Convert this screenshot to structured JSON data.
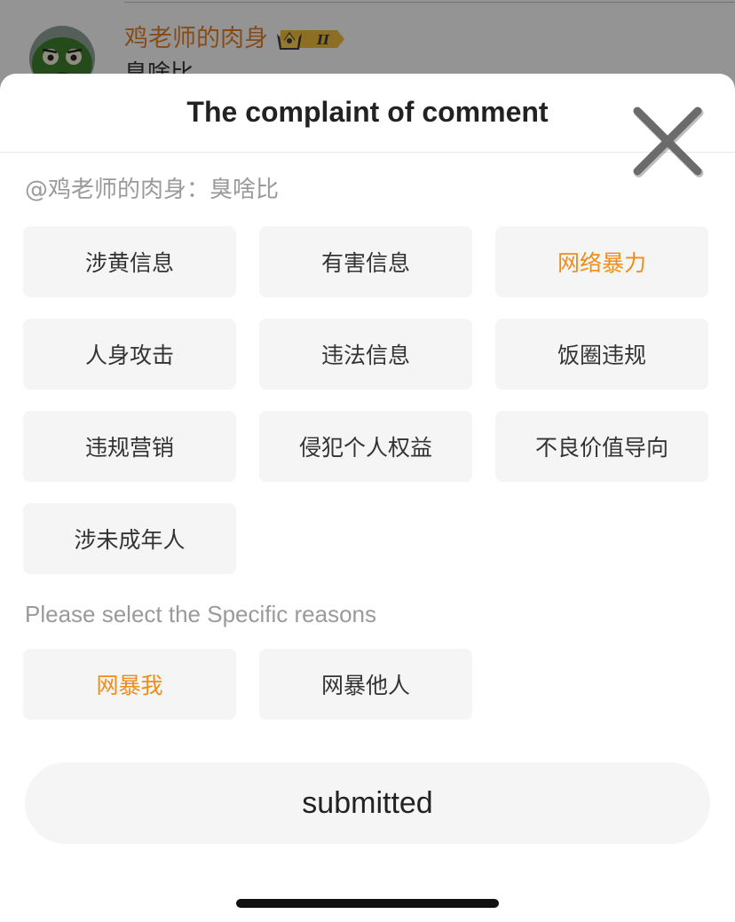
{
  "background_comment": {
    "username": "鸡老师的肉身",
    "comment_text": "臭啥比",
    "badge_level": "II",
    "icons": [
      "avatar-frog",
      "crown-badge"
    ]
  },
  "sheet": {
    "title": "The complaint of comment",
    "close_icon": "close-icon",
    "target_line": "@鸡老师的肉身：臭啥比",
    "categories": [
      {
        "label": "涉黄信息",
        "selected": false
      },
      {
        "label": "有害信息",
        "selected": false
      },
      {
        "label": "网络暴力",
        "selected": true
      },
      {
        "label": "人身攻击",
        "selected": false
      },
      {
        "label": "违法信息",
        "selected": false
      },
      {
        "label": "饭圈违规",
        "selected": false
      },
      {
        "label": "违规营销",
        "selected": false
      },
      {
        "label": "侵犯个人权益",
        "selected": false
      },
      {
        "label": "不良价值导向",
        "selected": false
      },
      {
        "label": "涉未成年人",
        "selected": false
      }
    ],
    "reason_title": "Please select the Specific reasons",
    "reasons": [
      {
        "label": "网暴我",
        "selected": true
      },
      {
        "label": "网暴他人",
        "selected": false
      }
    ],
    "submit_label": "submitted"
  },
  "colors": {
    "accent": "#f08c1a",
    "username": "#d97a24",
    "chip_bg": "#f5f5f5",
    "muted_text": "#9a9a9a"
  }
}
